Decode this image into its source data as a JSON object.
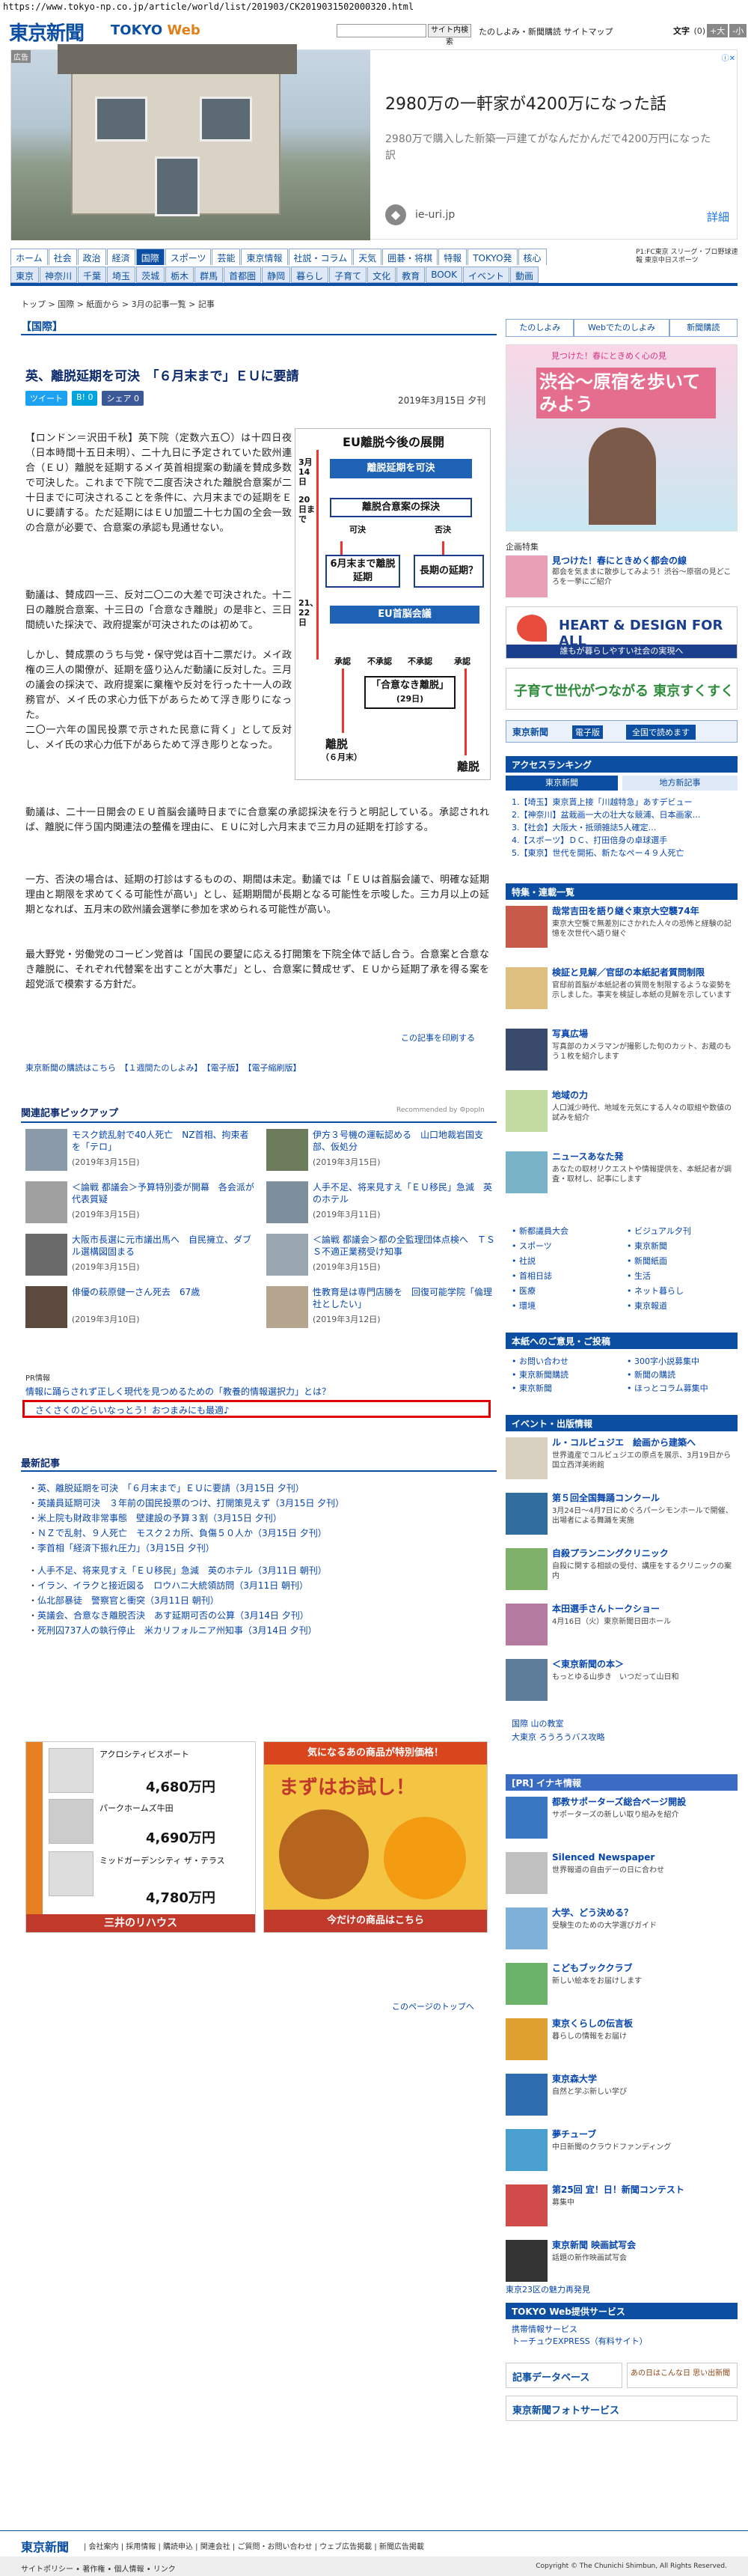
{
  "url": "https://www.tokyo-np.co.jp/article/world/list/201903/CK2019031502000320.html",
  "header": {
    "logo": "東京新聞",
    "logo_sub_a": "TOKYO ",
    "logo_sub_b": "Web",
    "search_button": "サイト内検索",
    "links": "たのしよみ・新聞購読 サイトマップ",
    "font_label": "文字",
    "font_count": "(0)",
    "font_up": "+大",
    "font_down": "-小"
  },
  "top_ad": {
    "label": "広告",
    "close": "ⓘ✕",
    "title": "2980万の一軒家が4200万になった話",
    "desc": "2980万で購入した新築一戸建てがなんだかんだで4200万円になった訳",
    "icon": "◆",
    "site": "ie-uri.jp",
    "detail": "詳細"
  },
  "nav_main": [
    "ホーム",
    "社会",
    "政治",
    "経済",
    "国際",
    "スポーツ",
    "芸能",
    "東京情報",
    "社説・コラム",
    "天気",
    "囲碁・将棋",
    "特報",
    "TOKYO発",
    "核心"
  ],
  "nav_sub": [
    "東京",
    "神奈川",
    "千葉",
    "埼玉",
    "茨城",
    "栃木",
    "群馬",
    "首都圏",
    "静岡",
    "暮らし",
    "子育て",
    "文化",
    "教育",
    "BOOK",
    "イベント",
    "動画"
  ],
  "chunichi": "P1:FC東京 スリーグ・プロ野球速報 東京中日スポーツ",
  "breadcrumb": "トップ > 国際 > 紙面から > 3月の記事一覧 > 記事",
  "section": "【国際】",
  "article": {
    "headline": "英、離脱延期を可決　「６月末まで」ＥＵに要請",
    "share": [
      "ツイート",
      "B! 0",
      "シェア 0"
    ],
    "date": "2019年3月15日 夕刊",
    "p1": "【ロンドン＝沢田千秋】英下院（定数六五〇）は十四日夜（日本時間十五日未明）、二十九日に予定されていた欧州連合（ＥＵ）離脱を延期するメイ英首相提案の動議を賛成多数で可決した。これまで下院で二度否決された離脱合意案が二十日までに可決されることを条件に、六月末までの延期をＥＵに要請する。ただ延期にはＥＵ加盟二十七カ国の全会一致の合意が必要で、合意案の承認も見通せない。",
    "p2": "動議は、賛成四一三、反対二〇二の大差で可決された。十二日の離脱合意案、十三日の「合意なき離脱」の是非と、三日間続いた採決で、政府提案が可決されたのは初めて。",
    "p3": "しかし、賛成票のうち与党・保守党は百十二票だけ。メイ政権の三人の閣僚が、延期を盛り込んだ動議に反対した。三月の議会の採決で、政府提案に棄権や反対を行った十一人の政務官が、メイ氏の求心力低下があらためて浮き彫りになった。",
    "p3b": "二〇一六年の国民投票で示された民意に背く」として反対し、メイ氏の求心力低下があらためて浮き彫りとなった。",
    "p4": "動議は、二十一日開会のＥＵ首脳会議時日までに合意案の承認採決を行うと明記している。承認されれば、離脱に伴う国内関連法の整備を理由に、ＥＵに対し六月末まで三カ月の延期を打診する。",
    "p5": "一方、否決の場合は、延期の打診はするものの、期間は未定。動議では「ＥＵは首脳会議で、明確な延期理由と期限を求めてくる可能性が高い」とし、延期期間が長期となる可能性を示唆した。三カ月以上の延期となれば、五月末の欧州議会選挙に参加を求められる可能性が高い。",
    "p6": "最大野党・労働党のコービン党首は「国民の要望に応える打開策を下院全体で話し合う。合意案と合意なき離脱に、それぞれ代替案を出すことが大事だ」とし、合意案に賛成せず、ＥＵから延期了承を得る案を超党派で模索する方針だ。",
    "print_link": "この記事を印刷する",
    "links_row": "東京新聞の購読はこちら　【１週間たのしよみ】　【電子版】　【電子縮刷版】"
  },
  "diagram": {
    "title": "EU離脱今後の展開",
    "d1": "3月14日",
    "box1": "離脱延期を可決",
    "d2": "20日まで",
    "box2": "離脱合意案の採決",
    "yes": "可決",
    "no": "否決",
    "box3": "6月末まで離脱延期",
    "box4": "長期の延期？",
    "d3": "21、22日",
    "box5": "EU首脳会議",
    "a1": "承認",
    "a2": "不承認",
    "a3": "不承認",
    "a4": "承認",
    "box6": "「合意なき離脱」",
    "box6d": "(29日)",
    "r1": "離脱",
    "r1d": "（６月末）",
    "r2": "離脱"
  },
  "related": {
    "title": "関連記事ピックアップ",
    "recommended": "Recommended by ⚙popIn",
    "items": [
      {
        "t": "モスク銃乱射で40人死亡　NZ首相、拘束者を「テロ」",
        "d": "(2019年3月15日)"
      },
      {
        "t": "伊方３号機の運転認める　山口地裁岩国支部、仮処分",
        "d": "(2019年3月15日)"
      },
      {
        "t": "＜論戦 都議会＞予算特別委が開幕　各会派が代表質疑",
        "d": "(2019年3月15日)"
      },
      {
        "t": "人手不足、将来見すえ「ＥＵ移民」急減　英のホテル",
        "d": "(2019年3月11日)"
      },
      {
        "t": "大阪市長選に元市議出馬へ　自民擁立、ダブル選構図固まる",
        "d": "(2019年3月15日)"
      },
      {
        "t": "＜論戦 都議会＞都の全監理団体点検へ　ＴＳＳ不適正業務受け知事",
        "d": "(2019年3月15日)"
      },
      {
        "t": "俳優の萩原健一さん死去　67歳",
        "d": "(2019年3月10日)"
      },
      {
        "t": "性教育是は専門店勝を　回復可能学院「倫理社としたい」",
        "d": "(2019年3月12日)"
      }
    ]
  },
  "pr": {
    "label": "PR情報",
    "link1": "情報に踊らされず正しく現代を見つめるための「教養的情報選択力」とは？",
    "link2": "さくさくのどらいなっとう！おつまみにも最適♪"
  },
  "news": {
    "title": "最新記事",
    "items": [
      "英、離脱延期を可決　「６月末まで」ＥＵに要請（3月15日 夕刊）",
      "英議員延期可決　３年前の国民投票のつけ、打開策見えず（3月15日 夕刊）",
      "米上院も財政非常事態　壁建設の予算３割（3月15日 夕刊）",
      "ＮＺで乱射、９人死亡　モスク２カ所、負傷５０人か（3月15日 夕刊）",
      "李首相「経済下振れ圧力」（3月15日 夕刊）",
      "人手不足、将来見すえ「ＥＵ移民」急減　英のホテル（3月11日 朝刊）",
      "イラン、イラクと接近図る　ロウハニ大統領訪問（3月11日 朝刊）",
      "仏北部暴徒　警察官と衝突（3月11日 朝刊）",
      "英議会、合意なき離脱否決　あす延期可否の公算（3月14日 夕刊）",
      "死刑囚737人の執行停止　米カリフォルニア州知事（3月14日 夕刊）"
    ]
  },
  "bottom_ad": {
    "l_title": "アクロシティビスポート",
    "p1": "4,680万円",
    "p2": "4,690万円",
    "p3": "4,780万円",
    "b2": "パークホームズ牛田",
    "b3": "ミッドガーデンシティ ザ・テラス",
    "brand": "三井のリハウス",
    "r_top": "気になるあの商品が特別価格！",
    "r_main": "まずはお試し！",
    "r_bottom": "今だけの商品はこちら"
  },
  "pagetop": "このページのトップへ",
  "side": {
    "tabs": [
      "たのしよみ",
      "Webでたのしよみ",
      "新聞購読"
    ],
    "ad1": "渋谷〜原宿を歩いてみよう",
    "ad1_sub": "見つけた！春にときめく心の見",
    "corp_label": "企画特集",
    "c1t": "見つけた！春にときめく都会の線",
    "c1d": "都会を気ままに散歩してみよう！渋谷〜原宿の見どころを一挙にご紹介",
    "c2": "HEART & DESIGN FOR ALL",
    "c2d": "誰もが暮らしやすい社会の実現へ",
    "c3": "子育て世代がつながる 東京すくすく",
    "e_logo": "東京新聞",
    "e_text": "電子版",
    "e_btn": "全国で読めます",
    "rank_h": "アクセスランキング",
    "rank_tabs": [
      "東京新聞",
      "地方新記事"
    ],
    "rank": [
      "1.【埼玉】東京貰上接「川越特急」あすデビュー",
      "2.【神奈川】盆栽画一大の壮大な競浦、日本画家…",
      "3.【社会】大阪大・抵頭雑誌5人確定…",
      "4.【スポーツ】ＤＣ、打田倍身の卓球選手",
      "5.【東京】世代を開拓、新たなペー４９人死亡"
    ],
    "feat_h": "特集・連載一覧",
    "f": [
      {
        "t": "哉常吉田を語り継ぐ東京大空襲74年",
        "d": "東京大空襲で無差別にさかれた人々の恐怖と経験の記憶を次世代へ語り継ぐ"
      },
      {
        "t": "検証と見解／官邸の本紙記者質問制限",
        "d": "官邸前首脳が本紙記者の質問を制限するような姿勢を示しました。事実を検証し本紙の見解を示しています"
      },
      {
        "t": "写真広場",
        "d": "写真部のカメラマンが撮影した旬のカット、お蔵のもう１枚を紹介します"
      },
      {
        "t": "地域の力",
        "d": "人口減少時代、地域を元気にする人々の取組や数値の試みを紹介"
      },
      {
        "t": "ニュースあなた発",
        "d": "あなたの取材リクエストや情報提供を、本紙記者が調査・取材し、記事にします"
      }
    ],
    "grid": [
      "新都議員大会",
      "ビジュアル夕刊",
      "スポーツ",
      "東京新聞",
      "社説",
      "新聞紙面",
      "首相日誌",
      "生活",
      "医療",
      "ネット暮らし",
      "環境",
      "東京報道"
    ],
    "svc_h": "本紙へのご意見・ご投稿",
    "svc": [
      "お問い合わせ",
      "300字小説募集中",
      "東京新聞購読",
      "新聞の購読",
      "東京新聞",
      "ほっとコラム募集中"
    ],
    "event_h": "イベント・出版情報",
    "ev": [
      {
        "t": "ル・コルビュジエ　絵画から建築へ",
        "d": "世界遺産でコルビュジエの原点を展示、3月19日から国立西洋美術館"
      },
      {
        "t": "第５回全国舞踊コンクール",
        "d": "3月24日〜4月7日にめぐろパーシモンホールで開催、出場者による舞踊を実施"
      },
      {
        "t": "自殺プランニングクリニック",
        "d": "自殺に関する相談の受付、講座をするクリニックの案内"
      },
      {
        "t": "本田選手さんトークショー",
        "d": "4月16日（火）東京新聞日田ホール"
      },
      {
        "t": "＜東京新聞の本＞",
        "d": "もっとゆる山歩き　いつだって山日和"
      }
    ],
    "oth": [
      "国際 山の教室",
      "大東京 ろうろうバス攻略"
    ],
    "pr_h": "[PR] イナキ情報",
    "pr": [
      {
        "t": "都教サポーターズ総合ページ開設",
        "d": "サポーターズの新しい取り組みを紹介"
      },
      {
        "t": "Silenced Newspaper",
        "d": "世界報道の自由デーの日に合わせ"
      },
      {
        "t": "大学、どう決める？",
        "d": "受験生のための大学選びガイド"
      },
      {
        "t": "こどもブッククラブ",
        "d": "新しい絵本をお届けします"
      },
      {
        "t": "東京くらしの伝言板",
        "d": "暮らしの情報をお届け"
      },
      {
        "t": "東京森大学",
        "d": "自然と学ぶ新しい学び"
      },
      {
        "t": "夢チューブ",
        "d": "中日新聞のクラウドファンディング"
      },
      {
        "t": "第25回 宜！日！新聞コンテスト",
        "d": "募集中"
      },
      {
        "t": "東京新聞 映画試写会",
        "d": "話題の新作映画試写会"
      }
    ],
    "tw": "東京23区の魅力再発見",
    "web_h": "TOKYO Web提供サービス",
    "web": [
      "携帯情報サービス",
      "トーチュウEXPRESS（有料サイト）"
    ],
    "db": "記事データベース",
    "p": "あの日はこんな日 思い出新聞",
    "photo": "東京新聞フォトサービス"
  },
  "footer": {
    "logo": "東京新聞",
    "links": "| 会社案内 | 採用情報 | 購読申込 | 関連会社 | ご質問・お問い合わせ | ウェブ広告掲載 | 新聞広告掲載",
    "bottom": "サイトポリシー • 著作権 • 個人情報 • リンク",
    "copyright": "Copyright © The Chunichi Shimbun, All Rights Reserved."
  }
}
